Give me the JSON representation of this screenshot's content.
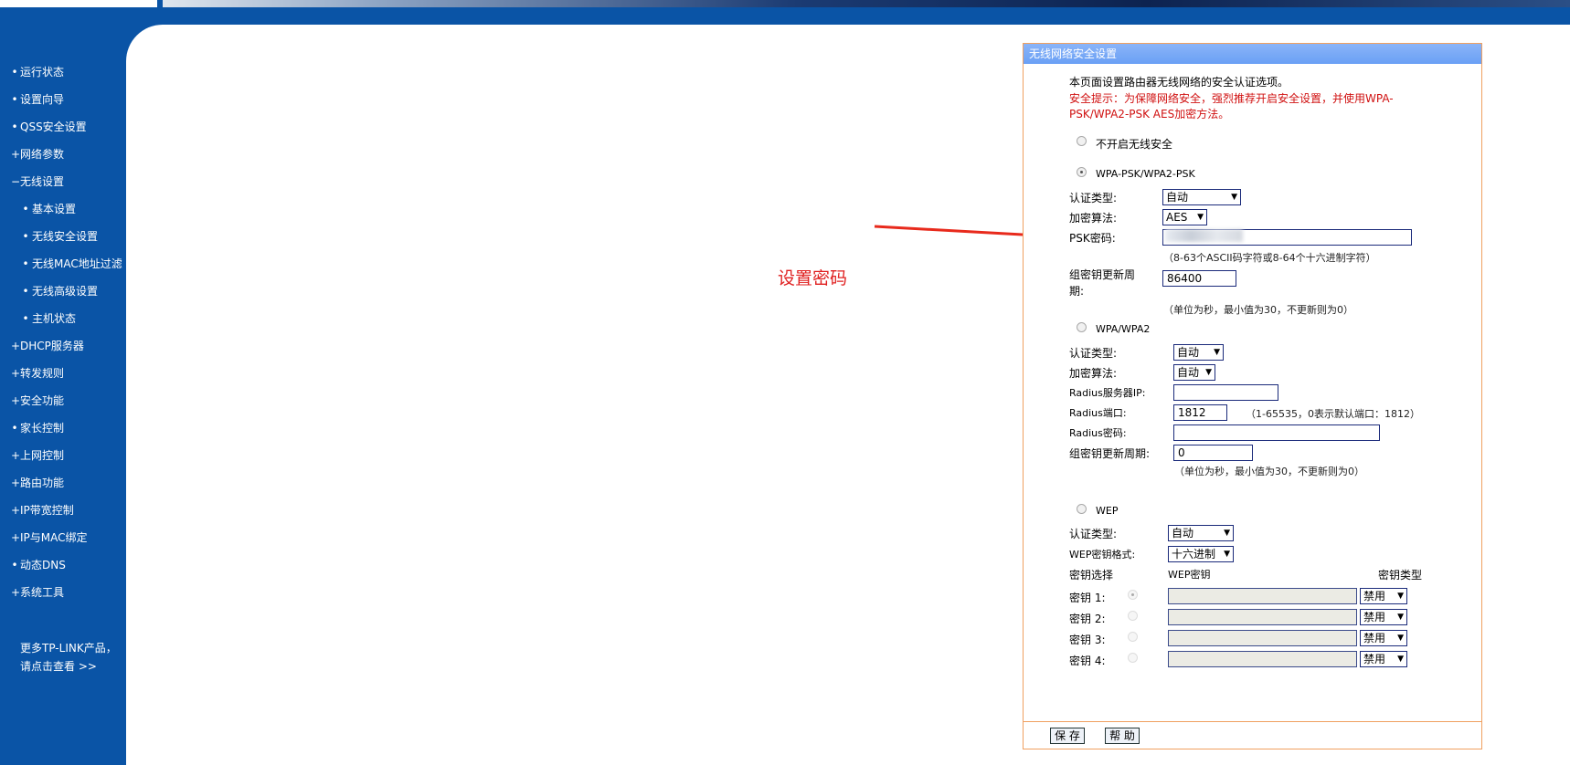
{
  "sidebar": {
    "items": [
      {
        "label": "运行状态",
        "bullet": "•",
        "sub": false
      },
      {
        "label": "设置向导",
        "bullet": "•",
        "sub": false
      },
      {
        "label": "QSS安全设置",
        "bullet": "•",
        "sub": false
      },
      {
        "label": "网络参数",
        "bullet": "+",
        "sub": false
      },
      {
        "label": "无线设置",
        "bullet": "−",
        "sub": false
      },
      {
        "label": "基本设置",
        "bullet": "•",
        "sub": true
      },
      {
        "label": "无线安全设置",
        "bullet": "•",
        "sub": true
      },
      {
        "label": "无线MAC地址过滤",
        "bullet": "•",
        "sub": true
      },
      {
        "label": "无线高级设置",
        "bullet": "•",
        "sub": true
      },
      {
        "label": "主机状态",
        "bullet": "•",
        "sub": true
      },
      {
        "label": "DHCP服务器",
        "bullet": "+",
        "sub": false
      },
      {
        "label": "转发规则",
        "bullet": "+",
        "sub": false
      },
      {
        "label": "安全功能",
        "bullet": "+",
        "sub": false
      },
      {
        "label": "家长控制",
        "bullet": "•",
        "sub": false
      },
      {
        "label": "上网控制",
        "bullet": "+",
        "sub": false
      },
      {
        "label": "路由功能",
        "bullet": "+",
        "sub": false
      },
      {
        "label": "IP带宽控制",
        "bullet": "+",
        "sub": false
      },
      {
        "label": "IP与MAC绑定",
        "bullet": "+",
        "sub": false
      },
      {
        "label": "动态DNS",
        "bullet": "•",
        "sub": false
      },
      {
        "label": "系统工具",
        "bullet": "+",
        "sub": false
      }
    ],
    "more_line1": "更多TP-LINK产品，",
    "more_line2": "请点击查看 >>"
  },
  "annotation": {
    "text": "设置密码",
    "color": "#e02020"
  },
  "panel": {
    "title": "无线网络安全设置",
    "intro": "本页面设置路由器无线网络的安全认证选项。",
    "warning_line1": "安全提示：为保障网络安全，强烈推荐开启安全设置，并使用WPA-",
    "warning_line2": "PSK/WPA2-PSK AES加密方法。",
    "opt_none": "不开启无线安全",
    "opt_psk": "WPA-PSK/WPA2-PSK",
    "psk": {
      "auth_label": "认证类型:",
      "auth_value": "自动",
      "enc_label": "加密算法:",
      "enc_value": "AES",
      "pwd_label": "PSK密码:",
      "pwd_hint": "（8-63个ASCII码字符或8-64个十六进制字符）",
      "period_label_1": "组密钥更新周",
      "period_label_2": "期:",
      "period_value": "86400",
      "period_hint": "（单位为秒，最小值为30，不更新则为0）"
    },
    "opt_wpa": "WPA/WPA2",
    "wpa": {
      "auth_label": "认证类型:",
      "auth_value": "自动",
      "enc_label": "加密算法:",
      "enc_value": "自动",
      "radius_ip_label": "Radius服务器IP:",
      "radius_ip_value": "",
      "radius_port_label": "Radius端口:",
      "radius_port_value": "1812",
      "radius_port_hint": "（1-65535，0表示默认端口：1812）",
      "radius_pwd_label": "Radius密码:",
      "radius_pwd_value": "",
      "period_label": "组密钥更新周期:",
      "period_value": "0",
      "period_hint": "（单位为秒，最小值为30，不更新则为0）"
    },
    "opt_wep": "WEP",
    "wep": {
      "auth_label": "认证类型:",
      "auth_value": "自动",
      "format_label": "WEP密钥格式:",
      "format_value": "十六进制",
      "col_select": "密钥选择",
      "col_key": "WEP密钥",
      "col_type": "密钥类型",
      "keys": [
        {
          "label": "密钥 1:",
          "type": "禁用"
        },
        {
          "label": "密钥 2:",
          "type": "禁用"
        },
        {
          "label": "密钥 3:",
          "type": "禁用"
        },
        {
          "label": "密钥 4:",
          "type": "禁用"
        }
      ]
    },
    "save_label": "保 存",
    "help_label": "帮 助"
  }
}
